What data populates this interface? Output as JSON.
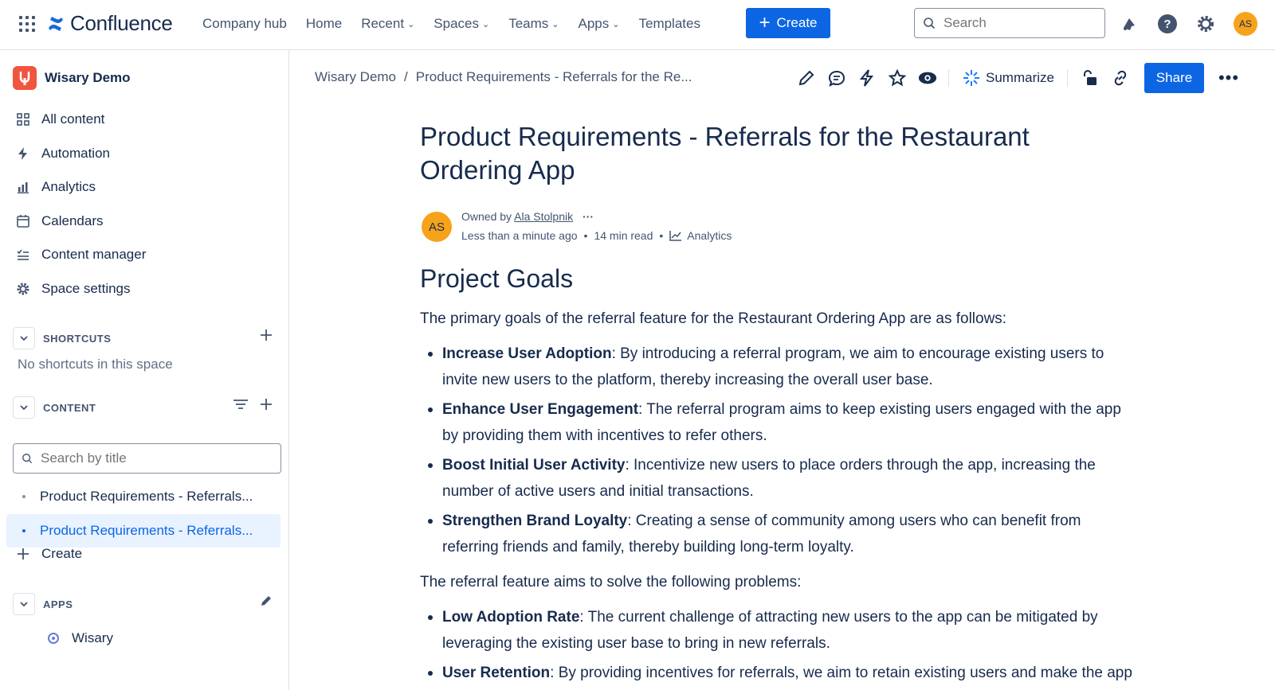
{
  "topnav": {
    "product_name": "Confluence",
    "links": [
      {
        "label": "Company hub",
        "has_menu": false
      },
      {
        "label": "Home",
        "has_menu": false
      },
      {
        "label": "Recent",
        "has_menu": true
      },
      {
        "label": "Spaces",
        "has_menu": true
      },
      {
        "label": "Teams",
        "has_menu": true
      },
      {
        "label": "Apps",
        "has_menu": true
      },
      {
        "label": "Templates",
        "has_menu": false
      }
    ],
    "create_label": "Create",
    "search_placeholder": "Search",
    "avatar_initials": "AS",
    "accent_color": "#0c66e4",
    "avatar_color": "#f7a21b"
  },
  "sidebar": {
    "space_name": "Wisary Demo",
    "items": [
      {
        "label": "All content",
        "icon": "grid-icon"
      },
      {
        "label": "Automation",
        "icon": "lightning-icon"
      },
      {
        "label": "Analytics",
        "icon": "bar-chart-icon"
      },
      {
        "label": "Calendars",
        "icon": "calendar-icon"
      },
      {
        "label": "Content manager",
        "icon": "checklist-icon"
      },
      {
        "label": "Space settings",
        "icon": "gear-icon"
      }
    ],
    "shortcuts": {
      "title": "SHORTCUTS",
      "empty_text": "No shortcuts in this space"
    },
    "content": {
      "title": "CONTENT",
      "search_placeholder": "Search by title",
      "pages": [
        {
          "label": "Product Requirements - Referrals...",
          "selected": false
        },
        {
          "label": "Product Requirements - Referrals...",
          "selected": true
        }
      ],
      "create_label": "Create"
    },
    "apps": {
      "title": "APPS",
      "items": [
        {
          "label": "Wisary"
        }
      ]
    }
  },
  "main": {
    "breadcrumb": {
      "space": "Wisary Demo",
      "separator": "/",
      "page": "Product Requirements - Referrals for the Re..."
    },
    "toolbar": {
      "summarize_label": "Summarize",
      "share_label": "Share"
    },
    "title": "Product Requirements - Referrals for the Restaurant Ordering App",
    "byline": {
      "owned_prefix": "Owned by",
      "owner": "Ala Stolpnik",
      "updated": "Less than a minute ago",
      "read_time": "14 min read",
      "analytics_label": "Analytics",
      "initials": "AS"
    },
    "heading": "Project Goals",
    "intro": "The primary goals of the referral feature for the Restaurant Ordering App are as follows:",
    "goals": [
      {
        "title": "Increase User Adoption",
        "text": ": By introducing a referral program, we aim to encourage existing users to invite new users to the platform, thereby increasing the overall user base."
      },
      {
        "title": "Enhance User Engagement",
        "text": ": The referral program aims to keep existing users engaged with the app by providing them with incentives to refer others."
      },
      {
        "title": "Boost Initial User Activity",
        "text": ": Incentivize new users to place orders through the app, increasing the number of active users and initial transactions."
      },
      {
        "title": "Strengthen Brand Loyalty",
        "text": ": Creating a sense of community among users who can benefit from referring friends and family, thereby building long-term loyalty."
      }
    ],
    "problems_intro": "The referral feature aims to solve the following problems:",
    "problems": [
      {
        "title": "Low Adoption Rate",
        "text": ": The current challenge of attracting new users to the app can be mitigated by leveraging the existing user base to bring in new referrals."
      },
      {
        "title": "User Retention",
        "text": ": By providing incentives for referrals, we aim to retain existing users and make the app"
      }
    ]
  }
}
